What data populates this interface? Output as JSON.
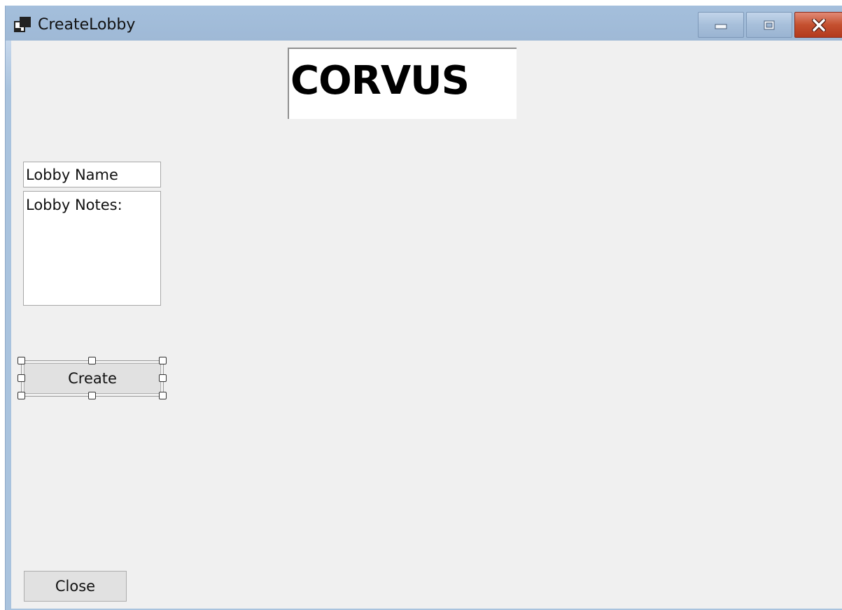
{
  "window": {
    "title": "CreateLobby",
    "icon": "app-window-icon",
    "controls": {
      "minimize_icon": "minimize-icon",
      "maximize_icon": "maximize-icon",
      "close_icon": "close-icon"
    },
    "colors": {
      "titlebar": "#a4bfdc",
      "client_background": "#f0f0f0",
      "close_button": "#c4502f"
    }
  },
  "logo": {
    "text": "CORVUS"
  },
  "form": {
    "lobby_name_value": "Lobby Name",
    "lobby_notes_value": "Lobby Notes:",
    "create_label": "Create",
    "close_label": "Close"
  },
  "designer": {
    "selected_control": "Create"
  }
}
